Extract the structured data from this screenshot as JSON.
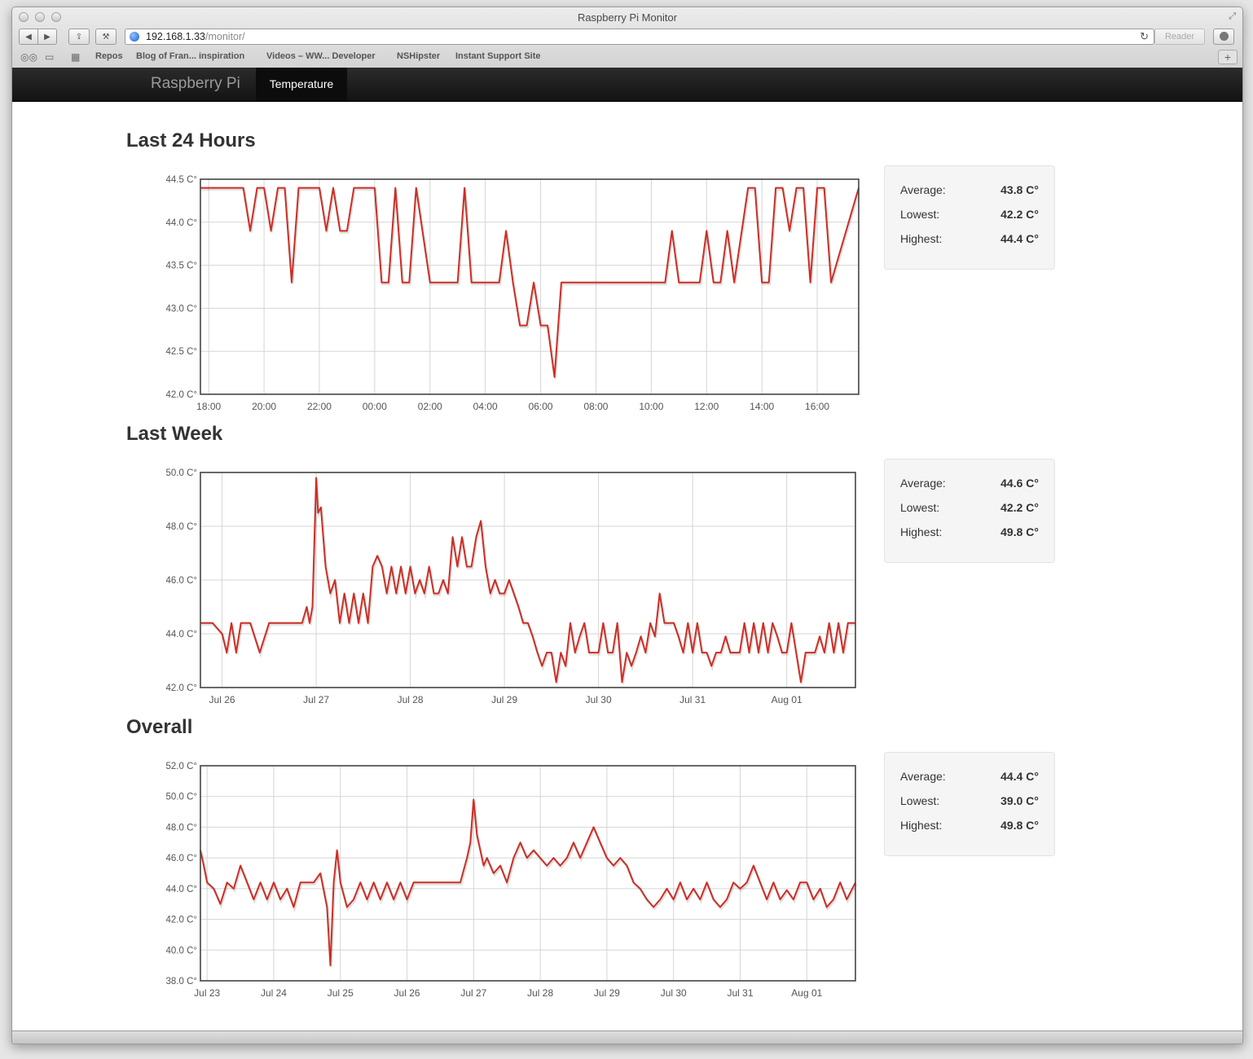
{
  "window": {
    "title": "Raspberry Pi Monitor"
  },
  "browser": {
    "url_host": "192.168.1.33",
    "url_path": "/monitor/",
    "reader_label": "Reader",
    "bookmarks": [
      "Repos",
      "Blog of Fran... inspiration",
      "Videos – WW... Developer",
      "NSHipster",
      "Instant Support Site"
    ]
  },
  "nav": {
    "brand": "Raspberry Pi",
    "active_tab": "Temperature"
  },
  "colors": {
    "line": "#cc2e24",
    "navbar": "#1b1b1b",
    "stats_bg": "#f5f5f5"
  },
  "stat_labels": {
    "average": "Average:",
    "lowest": "Lowest:",
    "highest": "Highest:"
  },
  "sections": [
    {
      "title": "Last 24 Hours",
      "stats": {
        "average": "43.8 C°",
        "lowest": "42.2 C°",
        "highest": "44.4 C°"
      },
      "chart_data": {
        "type": "line",
        "yticks": [
          "44.5 C°",
          "44.0 C°",
          "43.5 C°",
          "43.0 C°",
          "42.5 C°",
          "42.0 C°"
        ],
        "ylim": [
          42.0,
          44.5
        ],
        "xticks": [
          {
            "label": "18:00",
            "x": 18
          },
          {
            "label": "20:00",
            "x": 20
          },
          {
            "label": "22:00",
            "x": 22
          },
          {
            "label": "00:00",
            "x": 24
          },
          {
            "label": "02:00",
            "x": 26
          },
          {
            "label": "04:00",
            "x": 28
          },
          {
            "label": "06:00",
            "x": 30
          },
          {
            "label": "08:00",
            "x": 32
          },
          {
            "label": "10:00",
            "x": 34
          },
          {
            "label": "12:00",
            "x": 36
          },
          {
            "label": "14:00",
            "x": 38
          },
          {
            "label": "16:00",
            "x": 40
          }
        ],
        "xlim": [
          17.7,
          41.5
        ],
        "grid": true,
        "series": [
          {
            "x": [
              17.7,
              19.25,
              19.5,
              19.75,
              20.0,
              20.25,
              20.5,
              20.75,
              21.0,
              21.25,
              21.5,
              22.0,
              22.25,
              22.5,
              22.75,
              23.0,
              23.25,
              23.5,
              24.0,
              24.25,
              24.5,
              24.75,
              25.0,
              25.25,
              25.5,
              26.0,
              26.25,
              27.0,
              27.25,
              27.5,
              28.0,
              28.5,
              28.75,
              29.0,
              29.25,
              29.5,
              29.75,
              30.0,
              30.25,
              30.5,
              30.75,
              31.0,
              34.5,
              34.75,
              35.0,
              35.75,
              36.0,
              36.25,
              36.5,
              36.75,
              37.0,
              37.5,
              37.75,
              38.0,
              38.25,
              38.5,
              38.75,
              39.0,
              39.25,
              39.5,
              39.75,
              40.0,
              40.25,
              40.5,
              41.5
            ],
            "y": [
              44.4,
              44.4,
              43.9,
              44.4,
              44.4,
              43.9,
              44.4,
              44.4,
              43.3,
              44.4,
              44.4,
              44.4,
              43.9,
              44.4,
              43.9,
              43.9,
              44.4,
              44.4,
              44.4,
              43.3,
              43.3,
              44.4,
              43.3,
              43.3,
              44.4,
              43.3,
              43.3,
              43.3,
              44.4,
              43.3,
              43.3,
              43.3,
              43.9,
              43.3,
              42.8,
              42.8,
              43.3,
              42.8,
              42.8,
              42.2,
              43.3,
              43.3,
              43.3,
              43.9,
              43.3,
              43.3,
              43.9,
              43.3,
              43.3,
              43.9,
              43.3,
              44.4,
              44.4,
              43.3,
              43.3,
              44.4,
              44.4,
              43.9,
              44.4,
              44.4,
              43.3,
              44.4,
              44.4,
              43.3,
              44.4
            ]
          }
        ]
      }
    },
    {
      "title": "Last Week",
      "stats": {
        "average": "44.6 C°",
        "lowest": "42.2 C°",
        "highest": "49.8 C°"
      },
      "chart_data": {
        "type": "line",
        "yticks": [
          "50.0 C°",
          "48.0 C°",
          "46.0 C°",
          "44.0 C°",
          "42.0 C°"
        ],
        "ylim": [
          42.0,
          50.0
        ],
        "xticks": [
          {
            "label": "Jul 26",
            "x": 26
          },
          {
            "label": "Jul 27",
            "x": 27
          },
          {
            "label": "Jul 28",
            "x": 28
          },
          {
            "label": "Jul 29",
            "x": 29
          },
          {
            "label": "Jul 30",
            "x": 30
          },
          {
            "label": "Jul 31",
            "x": 31
          },
          {
            "label": "Aug 01",
            "x": 32
          }
        ],
        "xlim": [
          25.77,
          32.73
        ],
        "grid": true,
        "series": [
          {
            "x": [
              25.77,
              25.9,
              26.0,
              26.05,
              26.1,
              26.15,
              26.2,
              26.3,
              26.4,
              26.5,
              26.55,
              26.6,
              26.7,
              26.85,
              26.9,
              26.93,
              26.96,
              27.0,
              27.02,
              27.05,
              27.1,
              27.15,
              27.2,
              27.25,
              27.3,
              27.35,
              27.4,
              27.45,
              27.5,
              27.55,
              27.6,
              27.65,
              27.7,
              27.75,
              27.8,
              27.85,
              27.9,
              27.95,
              28.0,
              28.05,
              28.1,
              28.15,
              28.2,
              28.25,
              28.3,
              28.35,
              28.4,
              28.45,
              28.5,
              28.55,
              28.6,
              28.65,
              28.7,
              28.75,
              28.8,
              28.85,
              28.9,
              28.95,
              29.0,
              29.05,
              29.1,
              29.15,
              29.2,
              29.25,
              29.3,
              29.35,
              29.4,
              29.45,
              29.5,
              29.55,
              29.6,
              29.65,
              29.7,
              29.75,
              29.8,
              29.85,
              29.9,
              29.95,
              30.0,
              30.05,
              30.1,
              30.15,
              30.2,
              30.25,
              30.3,
              30.35,
              30.4,
              30.45,
              30.5,
              30.55,
              30.6,
              30.65,
              30.7,
              30.75,
              30.8,
              30.85,
              30.9,
              30.95,
              31.0,
              31.05,
              31.1,
              31.15,
              31.2,
              31.25,
              31.3,
              31.35,
              31.4,
              31.45,
              31.5,
              31.55,
              31.6,
              31.65,
              31.7,
              31.75,
              31.8,
              31.85,
              31.9,
              31.95,
              32.0,
              32.05,
              32.1,
              32.15,
              32.2,
              32.25,
              32.3,
              32.35,
              32.4,
              32.45,
              32.5,
              32.55,
              32.6,
              32.65,
              32.73
            ],
            "y": [
              44.4,
              44.4,
              44.0,
              43.3,
              44.4,
              43.3,
              44.4,
              44.4,
              43.3,
              44.4,
              44.4,
              44.4,
              44.4,
              44.4,
              45.0,
              44.4,
              45.0,
              49.8,
              48.5,
              48.7,
              46.5,
              45.5,
              46.0,
              44.4,
              45.5,
              44.4,
              45.5,
              44.4,
              45.5,
              44.4,
              46.5,
              46.9,
              46.5,
              45.5,
              46.5,
              45.5,
              46.5,
              45.5,
              46.5,
              45.5,
              46.0,
              45.5,
              46.5,
              45.5,
              45.5,
              46.0,
              45.5,
              47.6,
              46.5,
              47.6,
              46.5,
              46.5,
              47.6,
              48.2,
              46.5,
              45.5,
              46.0,
              45.5,
              45.5,
              46.0,
              45.5,
              45.0,
              44.4,
              44.4,
              43.9,
              43.3,
              42.8,
              43.3,
              43.3,
              42.2,
              43.3,
              42.8,
              44.4,
              43.3,
              43.9,
              44.4,
              43.3,
              43.3,
              43.3,
              44.4,
              43.3,
              43.3,
              44.4,
              42.2,
              43.3,
              42.8,
              43.3,
              43.9,
              43.3,
              44.4,
              43.9,
              45.5,
              44.4,
              44.4,
              44.4,
              43.9,
              43.3,
              44.4,
              43.3,
              44.4,
              43.3,
              43.3,
              42.8,
              43.3,
              43.3,
              43.9,
              43.3,
              43.3,
              43.3,
              44.4,
              43.3,
              44.4,
              43.3,
              44.4,
              43.3,
              44.4,
              43.9,
              43.3,
              43.3,
              44.4,
              43.3,
              42.2,
              43.3,
              43.3,
              43.3,
              43.9,
              43.3,
              44.4,
              43.3,
              44.4,
              43.3,
              44.4,
              44.4
            ]
          }
        ]
      }
    },
    {
      "title": "Overall",
      "stats": {
        "average": "44.4 C°",
        "lowest": "39.0 C°",
        "highest": "49.8 C°"
      },
      "chart_data": {
        "type": "line",
        "yticks": [
          "52.0 C°",
          "50.0 C°",
          "48.0 C°",
          "46.0 C°",
          "44.0 C°",
          "42.0 C°",
          "40.0 C°",
          "38.0 C°"
        ],
        "ylim": [
          38.0,
          52.0
        ],
        "xticks": [
          {
            "label": "Jul 23",
            "x": 23
          },
          {
            "label": "Jul 24",
            "x": 24
          },
          {
            "label": "Jul 25",
            "x": 25
          },
          {
            "label": "Jul 26",
            "x": 26
          },
          {
            "label": "Jul 27",
            "x": 27
          },
          {
            "label": "Jul 28",
            "x": 28
          },
          {
            "label": "Jul 29",
            "x": 29
          },
          {
            "label": "Jul 30",
            "x": 30
          },
          {
            "label": "Jul 31",
            "x": 31
          },
          {
            "label": "Aug 01",
            "x": 32
          }
        ],
        "xlim": [
          22.9,
          32.73
        ],
        "grid": true,
        "series": [
          {
            "x": [
              22.9,
              22.95,
              23.0,
              23.1,
              23.2,
              23.3,
              23.4,
              23.5,
              23.6,
              23.7,
              23.8,
              23.9,
              24.0,
              24.1,
              24.2,
              24.3,
              24.4,
              24.5,
              24.6,
              24.7,
              24.8,
              24.85,
              24.9,
              24.95,
              25.0,
              25.1,
              25.2,
              25.3,
              25.4,
              25.5,
              25.6,
              25.7,
              25.8,
              25.9,
              26.0,
              26.1,
              26.2,
              26.3,
              26.4,
              26.5,
              26.6,
              26.7,
              26.8,
              26.9,
              26.95,
              27.0,
              27.05,
              27.1,
              27.15,
              27.2,
              27.3,
              27.4,
              27.5,
              27.6,
              27.7,
              27.8,
              27.9,
              28.0,
              28.1,
              28.2,
              28.3,
              28.4,
              28.5,
              28.6,
              28.7,
              28.8,
              28.9,
              29.0,
              29.1,
              29.2,
              29.3,
              29.4,
              29.5,
              29.6,
              29.7,
              29.8,
              29.9,
              30.0,
              30.1,
              30.2,
              30.3,
              30.4,
              30.5,
              30.6,
              30.7,
              30.8,
              30.9,
              31.0,
              31.1,
              31.2,
              31.3,
              31.4,
              31.5,
              31.6,
              31.7,
              31.8,
              31.9,
              32.0,
              32.1,
              32.2,
              32.3,
              32.4,
              32.5,
              32.6,
              32.73
            ],
            "y": [
              46.5,
              45.5,
              44.4,
              44.0,
              43.0,
              44.4,
              44.0,
              45.5,
              44.4,
              43.3,
              44.4,
              43.3,
              44.4,
              43.3,
              44.0,
              42.8,
              44.4,
              44.4,
              44.4,
              45.0,
              42.8,
              39.0,
              44.4,
              46.5,
              44.4,
              42.8,
              43.3,
              44.4,
              43.3,
              44.4,
              43.3,
              44.4,
              43.3,
              44.4,
              43.3,
              44.4,
              44.4,
              44.4,
              44.4,
              44.4,
              44.4,
              44.4,
              44.4,
              46.0,
              47.0,
              49.8,
              47.5,
              46.5,
              45.5,
              46.0,
              45.0,
              45.5,
              44.4,
              46.0,
              47.0,
              46.0,
              46.5,
              46.0,
              45.5,
              46.0,
              45.5,
              46.0,
              47.0,
              46.0,
              47.0,
              48.0,
              47.0,
              46.0,
              45.5,
              46.0,
              45.5,
              44.4,
              44.0,
              43.3,
              42.8,
              43.3,
              44.0,
              43.3,
              44.4,
              43.3,
              44.0,
              43.3,
              44.4,
              43.3,
              42.8,
              43.3,
              44.4,
              44.0,
              44.4,
              45.5,
              44.4,
              43.3,
              44.4,
              43.3,
              43.9,
              43.3,
              44.4,
              44.4,
              43.3,
              44.0,
              42.8,
              43.3,
              44.4,
              43.3,
              44.4
            ]
          }
        ]
      }
    }
  ]
}
